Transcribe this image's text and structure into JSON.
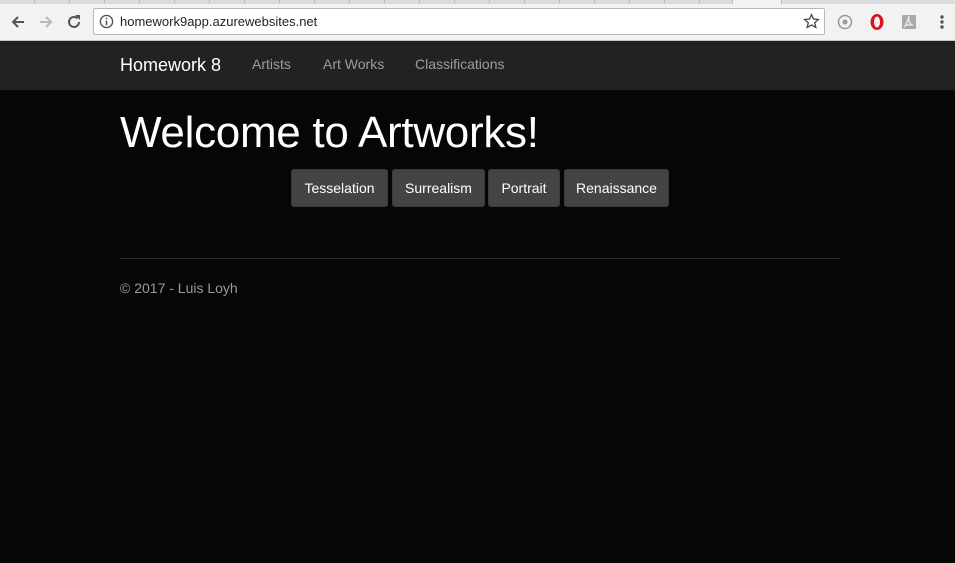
{
  "browser": {
    "url": "homework9app.azurewebsites.net",
    "icons": {
      "back": "back-arrow-icon",
      "forward": "forward-arrow-icon",
      "reload": "reload-icon",
      "info": "info-icon",
      "bookmark": "star-icon",
      "extensions": [
        "privacy-extension-icon",
        "opera-icon",
        "pdf-icon"
      ],
      "menu": "kebab-menu-icon"
    }
  },
  "navbar": {
    "brand": "Homework 8",
    "links": [
      "Artists",
      "Art Works",
      "Classifications"
    ]
  },
  "main": {
    "heading": "Welcome to Artworks!",
    "buttons": [
      "Tesselation",
      "Surrealism",
      "Portrait",
      "Renaissance"
    ]
  },
  "footer": {
    "text": "© 2017 - Luis Loyh"
  },
  "colors": {
    "page_bg": "#060606",
    "navbar_bg": "#222222",
    "nav_link": "#9d9d9d",
    "button_bg": "#444444",
    "footer_text": "#9b9b9b"
  }
}
